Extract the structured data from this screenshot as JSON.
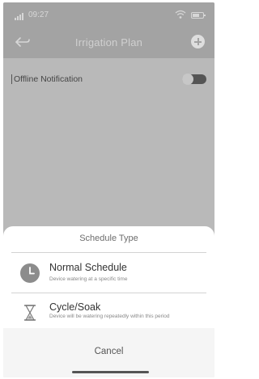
{
  "status": {
    "time": "09:27"
  },
  "header": {
    "title": "Irrigation Plan"
  },
  "settings": {
    "offline_notification_label": "Offline Notification",
    "offline_notification_enabled": false
  },
  "sheet": {
    "title": "Schedule Type",
    "options": [
      {
        "label": "Normal Schedule",
        "description": "Device watering at a specific time",
        "icon": "clock-icon"
      },
      {
        "label": "Cycle/Soak",
        "description": "Device will be watering repeatedly within this period",
        "icon": "hourglass-icon"
      }
    ],
    "cancel_label": "Cancel"
  }
}
